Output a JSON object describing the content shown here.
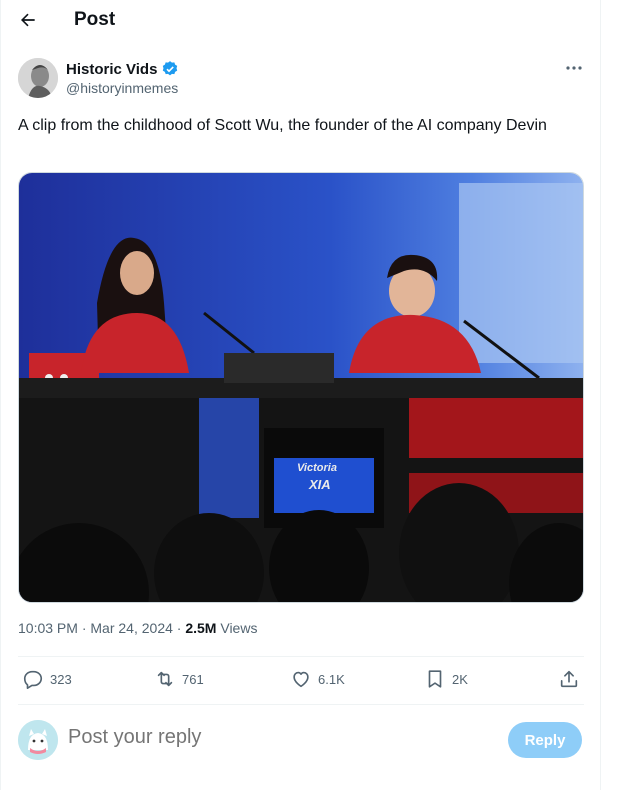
{
  "header": {
    "title": "Post"
  },
  "author": {
    "name": "Historic Vids",
    "handle": "@historyinmemes"
  },
  "tweet": {
    "text": "A clip from the childhood of Scott Wu, the founder of the AI company Devin"
  },
  "media": {
    "caption_line1": "Victoria",
    "caption_line2": "XIA"
  },
  "meta": {
    "time": "10:03 PM",
    "separator": "·",
    "date": "Mar 24, 2024",
    "views": "2.5M",
    "views_label": "Views"
  },
  "actions": {
    "replies": "323",
    "reposts": "761",
    "likes": "6.1K",
    "bookmarks": "2K"
  },
  "reply": {
    "placeholder": "Post your reply",
    "button_label": "Reply"
  },
  "colors": {
    "accent": "#1d9bf0",
    "verified": "#1d9bf0",
    "reply_button": "#8ecdf8",
    "muted_text": "#536471"
  }
}
